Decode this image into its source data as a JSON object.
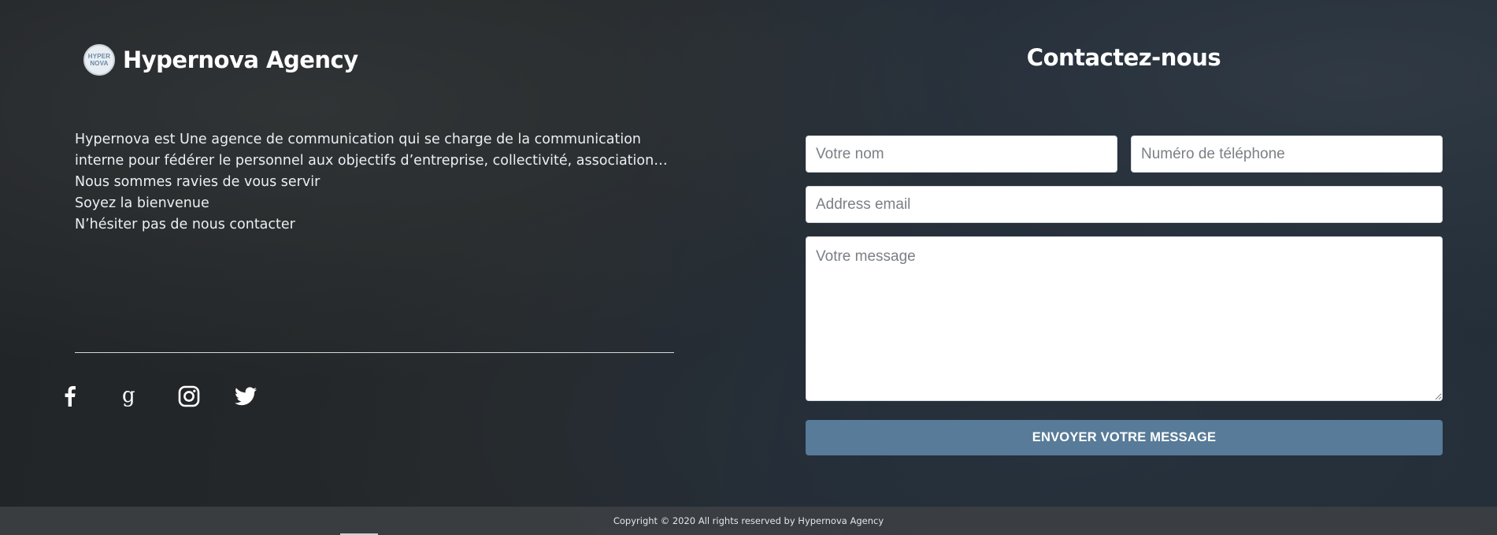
{
  "brand": {
    "logo_line1": "HYPER",
    "logo_line2": "NOVA",
    "name": "Hypernova Agency"
  },
  "about": {
    "lines": [
      "Hypernova est Une agence de communication qui se charge de la communication",
      "interne pour fédérer le personnel aux objectifs d’entreprise, collectivité, association…",
      "Nous sommes ravies de vous servir",
      "Soyez la bienvenue",
      "N’hésiter pas de nous contacter"
    ]
  },
  "socials": [
    {
      "icon": "facebook-icon"
    },
    {
      "icon": "google-icon"
    },
    {
      "icon": "instagram-icon"
    },
    {
      "icon": "twitter-icon"
    }
  ],
  "contact": {
    "title": "Contactez-nous",
    "name_placeholder": "Votre nom",
    "phone_placeholder": "Numéro de téléphone",
    "email_placeholder": "Address email",
    "message_placeholder": "Votre message",
    "submit_label": "ENVOYER VOTRE MESSAGE"
  },
  "footer": {
    "copyright": "Copyright © 2020 All rights reserved by Hypernova Agency"
  },
  "colors": {
    "button": "#577b98",
    "overlay": "#1c2632",
    "footer_bg": "#3c3f42"
  }
}
